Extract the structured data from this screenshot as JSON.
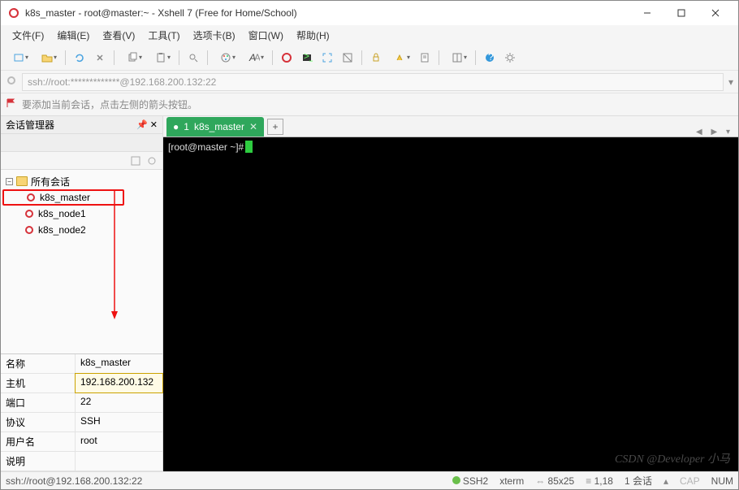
{
  "title": "k8s_master - root@master:~ - Xshell 7 (Free for Home/School)",
  "menubar": [
    "文件(F)",
    "编辑(E)",
    "查看(V)",
    "工具(T)",
    "选项卡(B)",
    "窗口(W)",
    "帮助(H)"
  ],
  "address": "ssh://root:*************@192.168.200.132:22",
  "tip": "要添加当前会话，点击左侧的箭头按钮。",
  "sidebar": {
    "title": "会话管理器",
    "root": "所有会话",
    "items": [
      "k8s_master",
      "k8s_node1",
      "k8s_node2"
    ]
  },
  "props": {
    "rows": [
      {
        "k": "名称",
        "v": "k8s_master"
      },
      {
        "k": "主机",
        "v": "192.168.200.132"
      },
      {
        "k": "端口",
        "v": "22"
      },
      {
        "k": "协议",
        "v": "SSH"
      },
      {
        "k": "用户名",
        "v": "root"
      },
      {
        "k": "说明",
        "v": ""
      }
    ]
  },
  "tab": {
    "index": "1",
    "name": "k8s_master",
    "plus": "+"
  },
  "terminal": {
    "prompt": "[root@master ~]#"
  },
  "watermark": "CSDN @Developer 小马",
  "status": {
    "addr": "ssh://root@192.168.200.132:22",
    "proto": "SSH2",
    "term": "xterm",
    "size": "85x25",
    "pos": "1,18",
    "sess": "1 会话",
    "cap": "CAP",
    "num": "NUM"
  },
  "icons": {
    "swirl_color": "#d6323a"
  }
}
